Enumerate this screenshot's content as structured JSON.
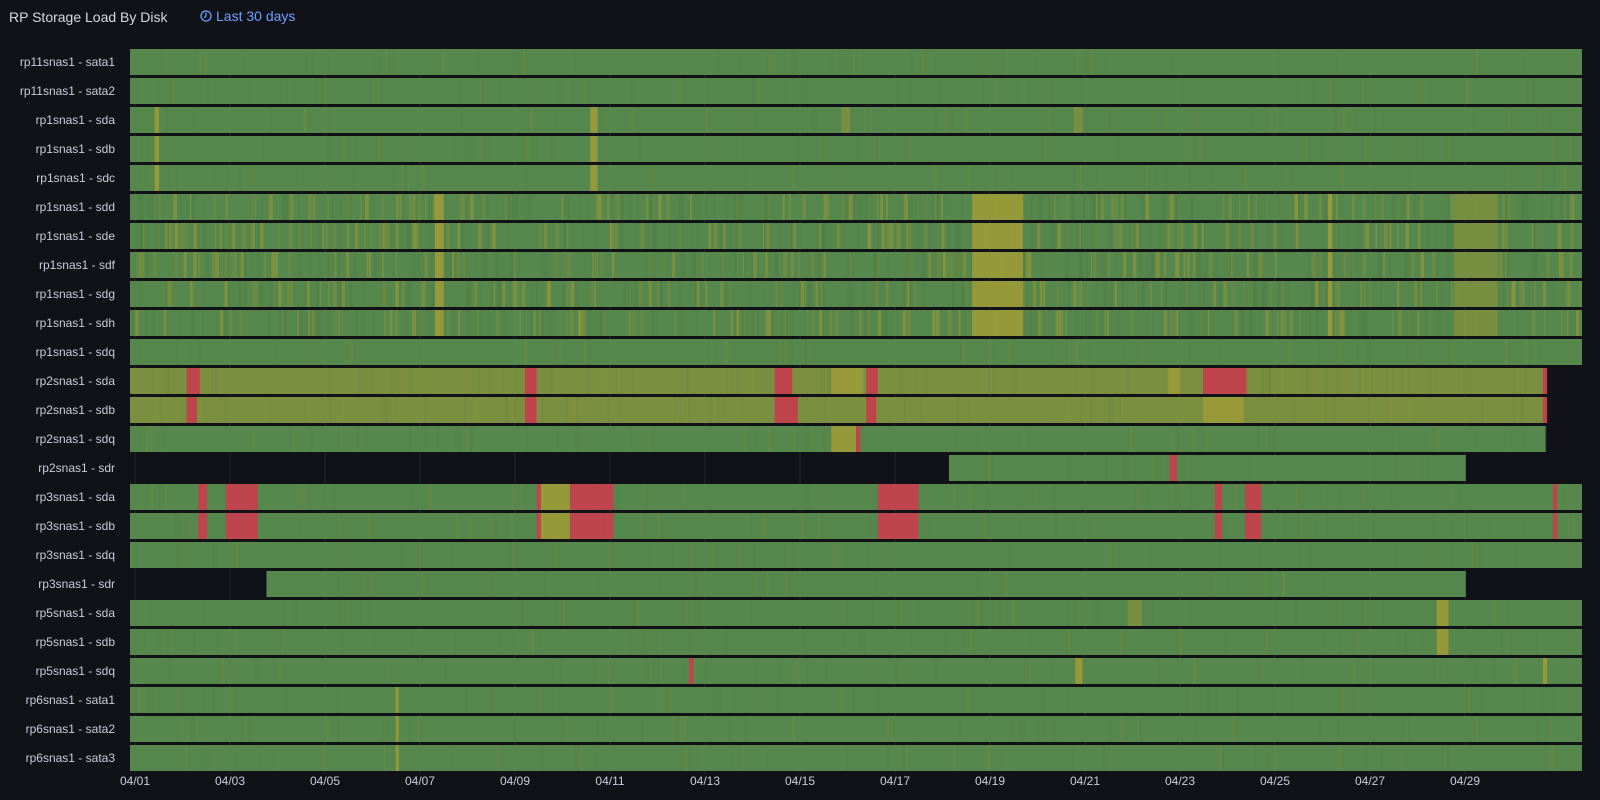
{
  "panel": {
    "title": "RP Storage Load By Disk",
    "time_range": "Last 30 days",
    "time_range_icon": "clock-icon"
  },
  "colors": {
    "background": "#111217",
    "low": "#56874c",
    "mid": "#9a9a38",
    "high": "#c4404d",
    "empty": "#111217",
    "accent": "#6e9fff"
  },
  "chart_data": {
    "type": "heatmap",
    "subtype": "state-timeline",
    "x_axis": {
      "type": "time",
      "start": "2024-04-01",
      "end": "2024-04-30",
      "tick_labels": [
        "04/01",
        "04/03",
        "04/05",
        "04/07",
        "04/09",
        "04/11",
        "04/13",
        "04/15",
        "04/17",
        "04/19",
        "04/21",
        "04/23",
        "04/25",
        "04/27",
        "04/29"
      ],
      "grid": true
    },
    "legend": "none",
    "color_scale": [
      "low",
      "mid",
      "high"
    ],
    "rows": [
      {
        "name": "rp11snas1 -  sata1",
        "start": "04/01",
        "end": "04/30",
        "events": []
      },
      {
        "name": "rp11snas1 -  sata2",
        "start": "04/01",
        "end": "04/30",
        "events": []
      },
      {
        "name": "rp1snas1 -  sda",
        "start": "04/01",
        "end": "04/30",
        "events": [
          {
            "t": 0.017,
            "w": 0.003,
            "level": "mid"
          },
          {
            "t": 0.317,
            "w": 0.005,
            "level": "mid"
          },
          {
            "t": 0.49,
            "w": 0.006,
            "level": "low-mid"
          },
          {
            "t": 0.65,
            "w": 0.006,
            "level": "low-mid"
          }
        ]
      },
      {
        "name": "rp1snas1 -  sdb",
        "start": "04/01",
        "end": "04/30",
        "events": [
          {
            "t": 0.017,
            "w": 0.003,
            "level": "mid"
          },
          {
            "t": 0.317,
            "w": 0.005,
            "level": "mid"
          }
        ]
      },
      {
        "name": "rp1snas1 -  sdc",
        "start": "04/01",
        "end": "04/30",
        "events": [
          {
            "t": 0.017,
            "w": 0.003,
            "level": "mid"
          },
          {
            "t": 0.317,
            "w": 0.005,
            "level": "mid"
          }
        ]
      },
      {
        "name": "rp1snas1 -  sdd",
        "start": "04/01",
        "end": "04/30",
        "busy": true,
        "events": [
          {
            "t": 0.21,
            "w": 0.006,
            "level": "mid"
          },
          {
            "t": 0.58,
            "w": 0.035,
            "level": "mid"
          },
          {
            "t": 0.825,
            "w": 0.003,
            "level": "mid"
          },
          {
            "t": 0.912,
            "w": 0.03,
            "level": "low-mid"
          }
        ]
      },
      {
        "name": "rp1snas1 -  sde",
        "start": "04/01",
        "end": "04/30",
        "busy": true,
        "events": [
          {
            "t": 0.21,
            "w": 0.006,
            "level": "mid"
          },
          {
            "t": 0.58,
            "w": 0.035,
            "level": "mid"
          },
          {
            "t": 0.825,
            "w": 0.003,
            "level": "mid"
          },
          {
            "t": 0.912,
            "w": 0.03,
            "level": "low-mid"
          }
        ]
      },
      {
        "name": "rp1snas1 -  sdf",
        "start": "04/01",
        "end": "04/30",
        "busy": true,
        "events": [
          {
            "t": 0.21,
            "w": 0.006,
            "level": "mid"
          },
          {
            "t": 0.58,
            "w": 0.035,
            "level": "mid"
          },
          {
            "t": 0.825,
            "w": 0.003,
            "level": "mid"
          },
          {
            "t": 0.912,
            "w": 0.03,
            "level": "low-mid"
          }
        ]
      },
      {
        "name": "rp1snas1 -  sdg",
        "start": "04/01",
        "end": "04/30",
        "busy": true,
        "events": [
          {
            "t": 0.21,
            "w": 0.006,
            "level": "mid"
          },
          {
            "t": 0.58,
            "w": 0.035,
            "level": "mid"
          },
          {
            "t": 0.825,
            "w": 0.003,
            "level": "mid"
          },
          {
            "t": 0.912,
            "w": 0.03,
            "level": "low-mid"
          }
        ]
      },
      {
        "name": "rp1snas1 -  sdh",
        "start": "04/01",
        "end": "04/30",
        "busy": true,
        "events": [
          {
            "t": 0.21,
            "w": 0.006,
            "level": "mid"
          },
          {
            "t": 0.58,
            "w": 0.035,
            "level": "mid"
          },
          {
            "t": 0.825,
            "w": 0.003,
            "level": "mid"
          },
          {
            "t": 0.912,
            "w": 0.03,
            "level": "low-mid"
          }
        ]
      },
      {
        "name": "rp1snas1 -  sdq",
        "start": "04/01",
        "end": "04/30",
        "events": []
      },
      {
        "name": "rp2snas1 -  sda",
        "start": "04/01",
        "end": "04/30",
        "base": "low-mid",
        "events": [
          {
            "t": 0.039,
            "w": 0.009,
            "level": "high"
          },
          {
            "t": 0.272,
            "w": 0.008,
            "level": "high"
          },
          {
            "t": 0.444,
            "w": 0.012,
            "level": "high"
          },
          {
            "t": 0.483,
            "w": 0.022,
            "level": "mid"
          },
          {
            "t": 0.507,
            "w": 0.008,
            "level": "high"
          },
          {
            "t": 0.715,
            "w": 0.008,
            "level": "mid"
          },
          {
            "t": 0.739,
            "w": 0.03,
            "level": "high"
          },
          {
            "t": 0.973,
            "w": 0.003,
            "level": "high"
          }
        ],
        "end_gap": 0.025
      },
      {
        "name": "rp2snas1 -  sdb",
        "start": "04/01",
        "end": "04/30",
        "base": "low-mid",
        "events": [
          {
            "t": 0.039,
            "w": 0.007,
            "level": "high"
          },
          {
            "t": 0.272,
            "w": 0.008,
            "level": "high"
          },
          {
            "t": 0.444,
            "w": 0.016,
            "level": "high"
          },
          {
            "t": 0.483,
            "w": 0.022,
            "level": "low-mid"
          },
          {
            "t": 0.507,
            "w": 0.007,
            "level": "high"
          },
          {
            "t": 0.715,
            "w": 0.006,
            "level": "low-mid"
          },
          {
            "t": 0.739,
            "w": 0.028,
            "level": "mid"
          },
          {
            "t": 0.973,
            "w": 0.003,
            "level": "high"
          }
        ],
        "end_gap": 0.025
      },
      {
        "name": "rp2snas1 -  sdq",
        "start": "04/01",
        "end": "04/30",
        "events": [
          {
            "t": 0.483,
            "w": 0.017,
            "level": "mid"
          },
          {
            "t": 0.5,
            "w": 0.003,
            "level": "high"
          }
        ],
        "end_gap": 0.025
      },
      {
        "name": "rp2snas1 -  sdr",
        "start": "04/18",
        "end": "04/29",
        "offset": 0.564,
        "events": [
          {
            "t": 0.716,
            "w": 0.005,
            "level": "high"
          }
        ],
        "end_gap": 0.08
      },
      {
        "name": "rp3snas1 -  sda",
        "start": "04/01",
        "end": "04/30",
        "events": [
          {
            "t": 0.047,
            "w": 0.006,
            "level": "high"
          },
          {
            "t": 0.066,
            "w": 0.01,
            "level": "high"
          },
          {
            "t": 0.076,
            "w": 0.012,
            "level": "high"
          },
          {
            "t": 0.28,
            "w": 0.003,
            "level": "high"
          },
          {
            "t": 0.283,
            "w": 0.02,
            "level": "mid"
          },
          {
            "t": 0.303,
            "w": 0.03,
            "level": "high"
          },
          {
            "t": 0.515,
            "w": 0.028,
            "level": "high"
          },
          {
            "t": 0.747,
            "w": 0.005,
            "level": "high"
          },
          {
            "t": 0.768,
            "w": 0.011,
            "level": "high"
          },
          {
            "t": 0.98,
            "w": 0.003,
            "level": "high"
          }
        ]
      },
      {
        "name": "rp3snas1 -  sdb",
        "start": "04/01",
        "end": "04/30",
        "events": [
          {
            "t": 0.047,
            "w": 0.006,
            "level": "high"
          },
          {
            "t": 0.066,
            "w": 0.01,
            "level": "high"
          },
          {
            "t": 0.076,
            "w": 0.012,
            "level": "high"
          },
          {
            "t": 0.28,
            "w": 0.003,
            "level": "high"
          },
          {
            "t": 0.283,
            "w": 0.02,
            "level": "mid"
          },
          {
            "t": 0.303,
            "w": 0.03,
            "level": "high"
          },
          {
            "t": 0.515,
            "w": 0.028,
            "level": "high"
          },
          {
            "t": 0.747,
            "w": 0.005,
            "level": "high"
          },
          {
            "t": 0.768,
            "w": 0.011,
            "level": "high"
          },
          {
            "t": 0.98,
            "w": 0.003,
            "level": "high"
          }
        ]
      },
      {
        "name": "rp3snas1 -  sdq",
        "start": "04/01",
        "end": "04/30",
        "events": []
      },
      {
        "name": "rp3snas1 -  sdr",
        "start": "04/03",
        "end": "04/29",
        "offset": 0.094,
        "events": [],
        "end_gap": 0.08
      },
      {
        "name": "rp5snas1 -  sda",
        "start": "04/01",
        "end": "04/30",
        "events": [
          {
            "t": 0.687,
            "w": 0.01,
            "level": "low-mid"
          },
          {
            "t": 0.9,
            "w": 0.008,
            "level": "mid"
          }
        ]
      },
      {
        "name": "rp5snas1 -  sdb",
        "start": "04/01",
        "end": "04/30",
        "events": [
          {
            "t": 0.9,
            "w": 0.008,
            "level": "mid"
          }
        ]
      },
      {
        "name": "rp5snas1 -  sdq",
        "start": "04/01",
        "end": "04/30",
        "events": [
          {
            "t": 0.385,
            "w": 0.003,
            "level": "high"
          },
          {
            "t": 0.651,
            "w": 0.005,
            "level": "mid"
          },
          {
            "t": 0.973,
            "w": 0.003,
            "level": "mid"
          }
        ]
      },
      {
        "name": "rp6snas1 -  sata1",
        "start": "04/01",
        "end": "04/30",
        "events": [
          {
            "t": 0.183,
            "w": 0.002,
            "level": "mid"
          }
        ]
      },
      {
        "name": "rp6snas1 -  sata2",
        "start": "04/01",
        "end": "04/30",
        "events": [
          {
            "t": 0.183,
            "w": 0.002,
            "level": "mid"
          }
        ]
      },
      {
        "name": "rp6snas1 -  sata3",
        "start": "04/01",
        "end": "04/30",
        "events": [
          {
            "t": 0.183,
            "w": 0.002,
            "level": "mid"
          }
        ]
      }
    ]
  }
}
